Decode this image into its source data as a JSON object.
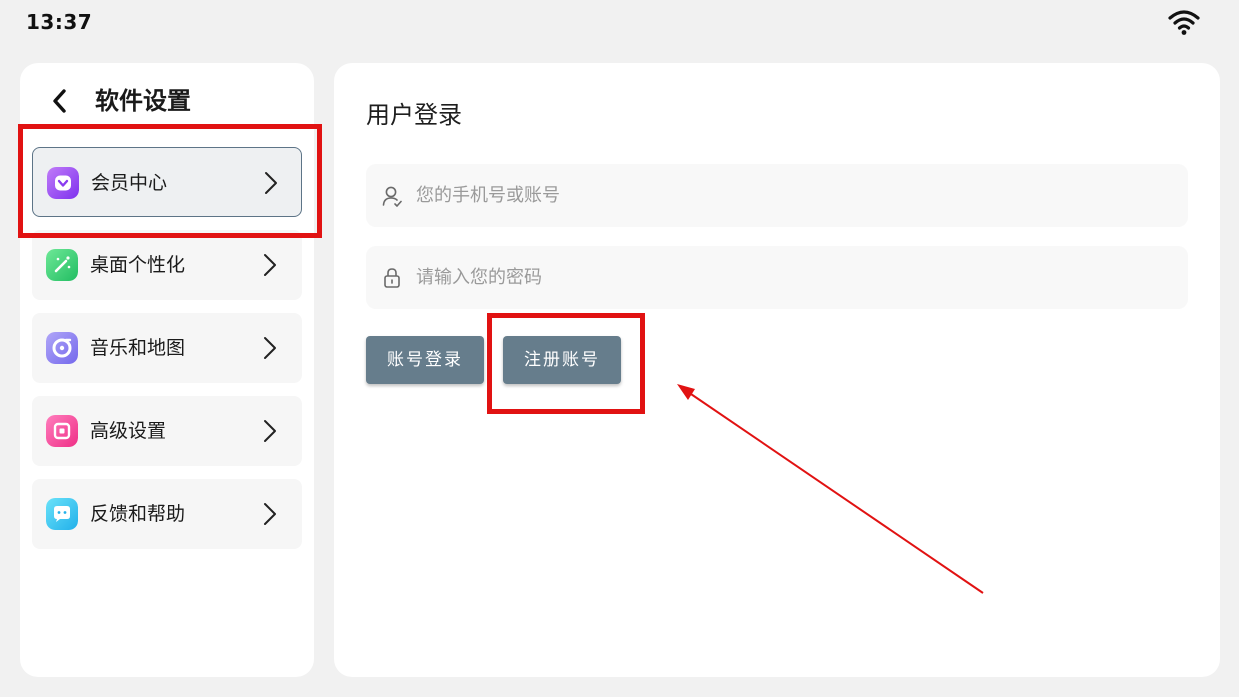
{
  "status_bar": {
    "time": "13:37",
    "wifi_icon": "wifi-icon"
  },
  "sidebar": {
    "back_icon": "chevron-left-icon",
    "title": "软件设置",
    "items": [
      {
        "label": "会员中心",
        "icon": "heart-badge-icon",
        "icon_colors": [
          "#b768f6",
          "#8a3cf0"
        ],
        "selected": true
      },
      {
        "label": "桌面个性化",
        "icon": "magic-wand-icon",
        "icon_colors": [
          "#5fe08a",
          "#2cc36a"
        ],
        "selected": false
      },
      {
        "label": "音乐和地图",
        "icon": "music-disc-icon",
        "icon_colors": [
          "#a59bf7",
          "#7f74ee"
        ],
        "selected": false
      },
      {
        "label": "高级设置",
        "icon": "settings-chip-icon",
        "icon_colors": [
          "#ff6fb5",
          "#f43a8e"
        ],
        "selected": false
      },
      {
        "label": "反馈和帮助",
        "icon": "chat-bubble-icon",
        "icon_colors": [
          "#5fdcf7",
          "#2bb8ec"
        ],
        "selected": false
      }
    ]
  },
  "login": {
    "title": "用户登录",
    "account_field": {
      "value": "",
      "placeholder": "您的手机号或账号",
      "icon": "user-icon"
    },
    "password_field": {
      "value": "",
      "placeholder": "请输入您的密码",
      "icon": "lock-icon"
    },
    "login_button": "账号登录",
    "register_button": "注册账号"
  },
  "colors": {
    "button": "#667d8c",
    "annotation_red": "#e11212",
    "selected_border": "#5d7487"
  }
}
